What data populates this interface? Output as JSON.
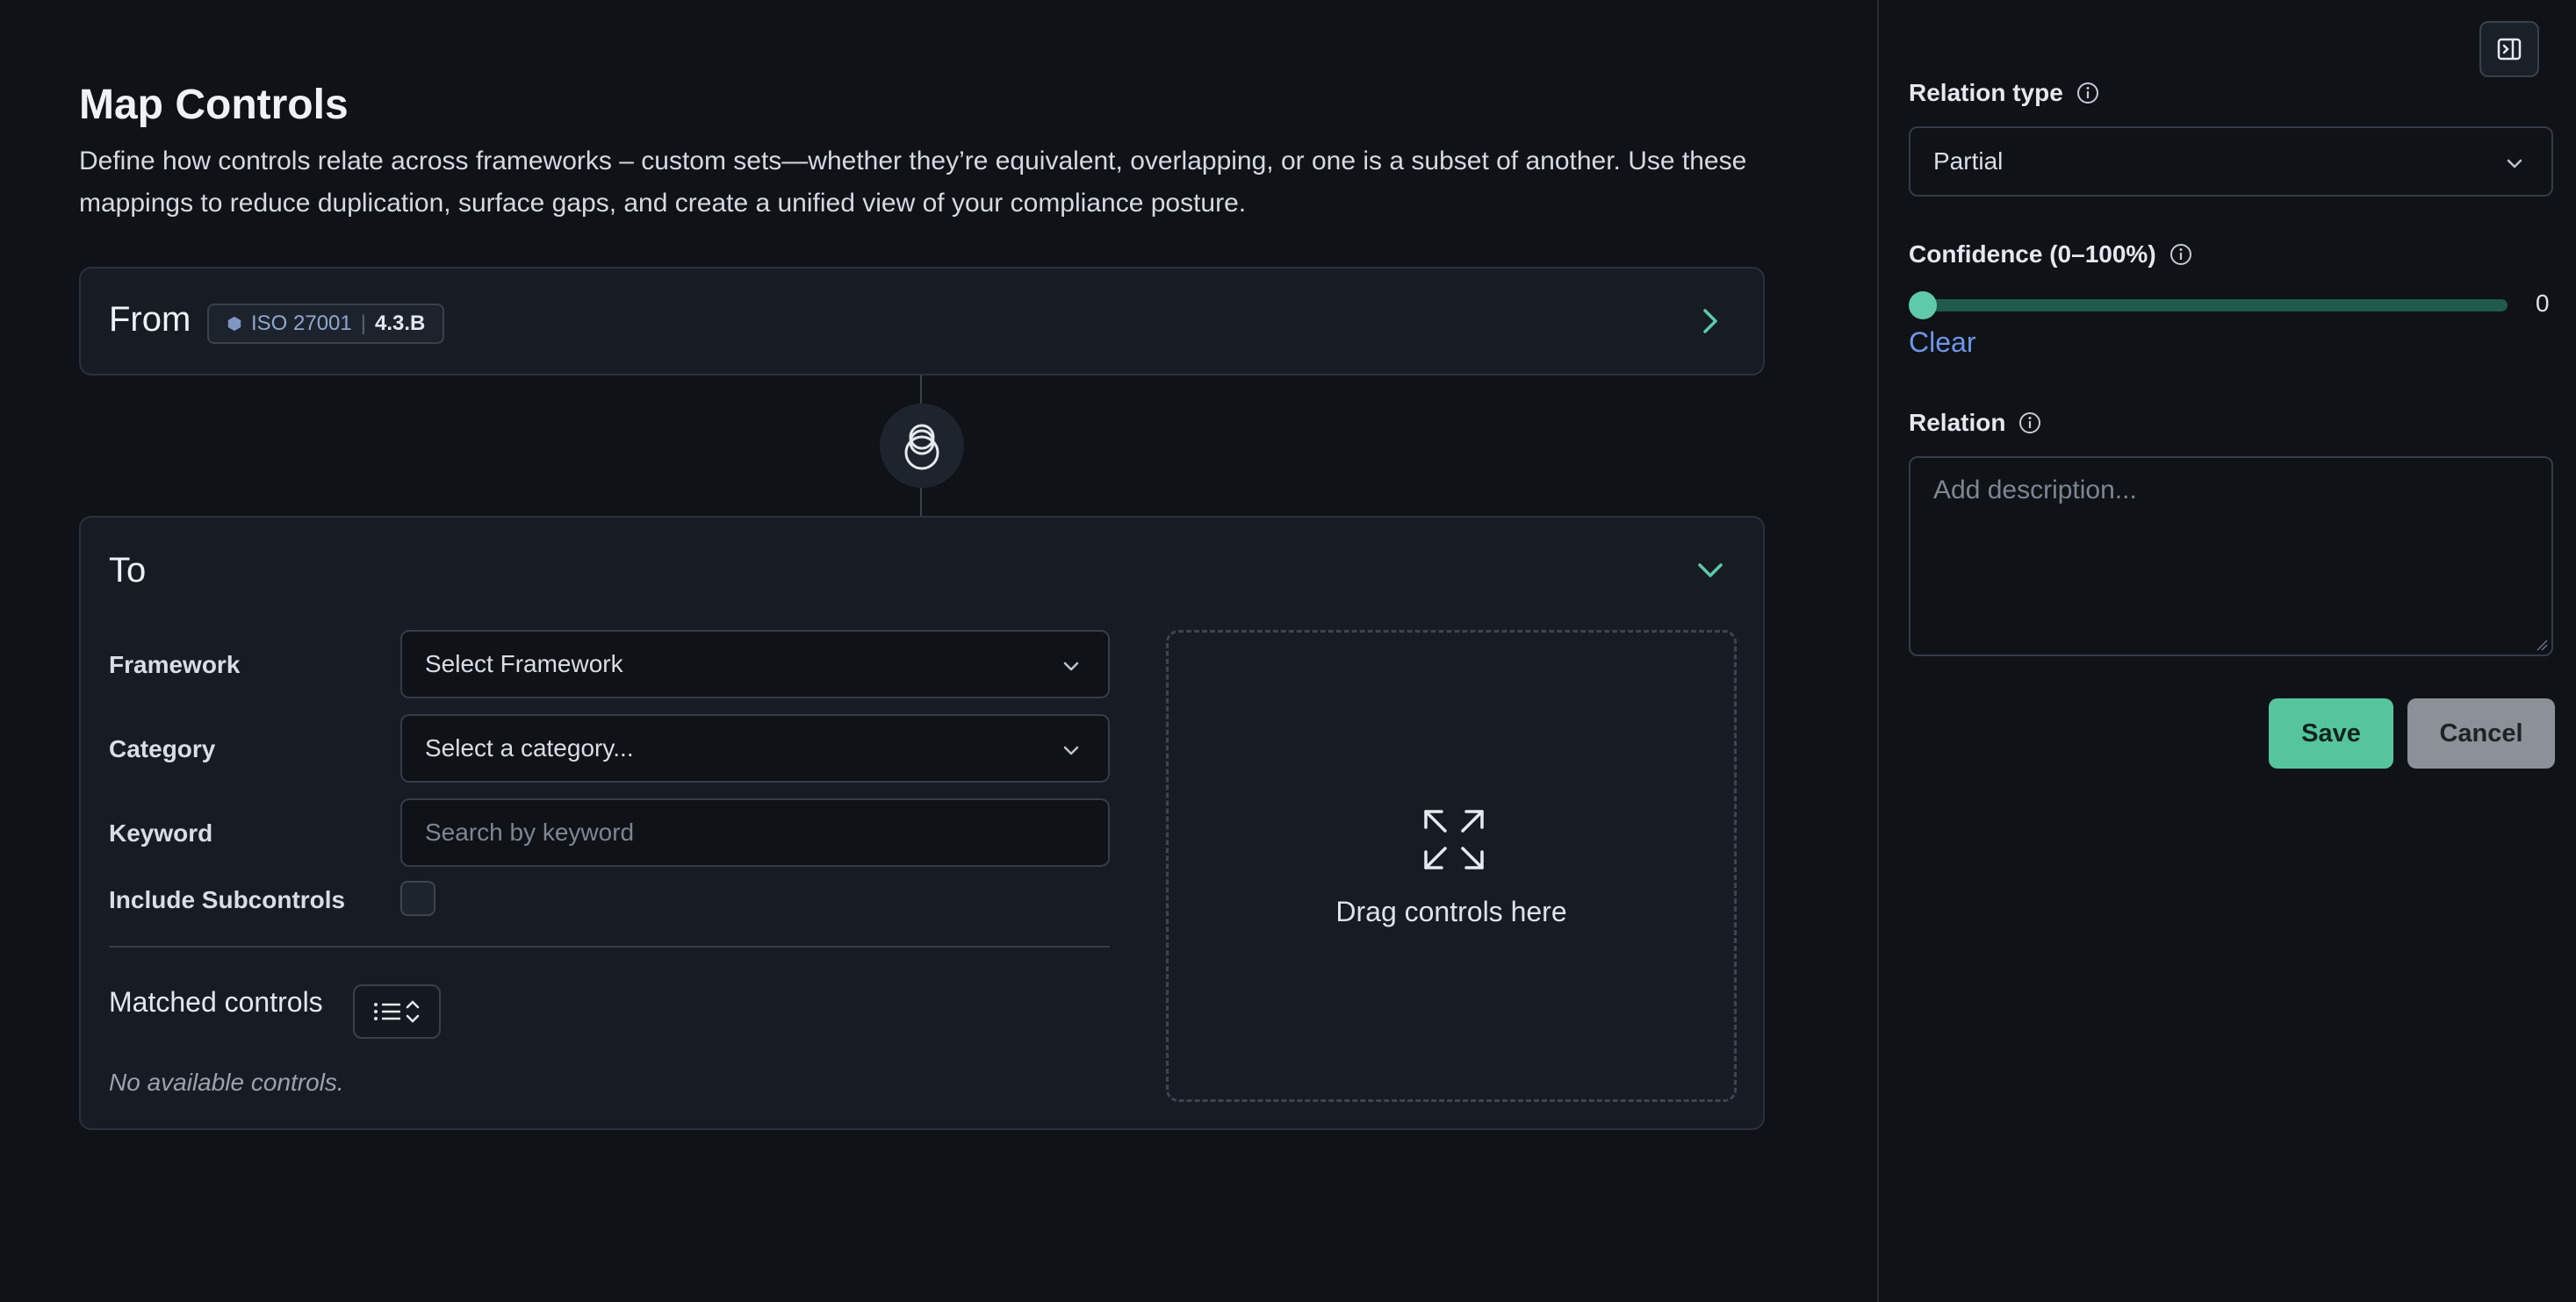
{
  "page": {
    "title": "Map Controls",
    "description": "Define how controls relate across frameworks – custom sets—whether they’re equivalent, overlapping, or one is a subset of another. Use these mappings to reduce duplication, surface gaps, and create a unified view of your compliance posture."
  },
  "from": {
    "label": "From",
    "framework": "ISO 27001",
    "separator": "|",
    "control_code": "4.3.B"
  },
  "to": {
    "label": "To",
    "framework_label": "Framework",
    "framework_value": "Select Framework",
    "category_label": "Category",
    "category_value": "Select a category...",
    "keyword_label": "Keyword",
    "keyword_placeholder": "Search by keyword",
    "subcontrols_label": "Include Subcontrols",
    "matched_label": "Matched controls",
    "empty_text": "No available controls.",
    "drop_text": "Drag controls here"
  },
  "panel": {
    "relation_type_label": "Relation type",
    "relation_type_value": "Partial",
    "confidence_label": "Confidence (0–100%)",
    "confidence_value": "0",
    "clear_label": "Clear",
    "relation_label": "Relation",
    "relation_placeholder": "Add description...",
    "save_label": "Save",
    "cancel_label": "Cancel"
  },
  "colors": {
    "background": "#0f1217",
    "card": "#171c24",
    "accent": "#56c59e",
    "link": "#6f95e6"
  }
}
